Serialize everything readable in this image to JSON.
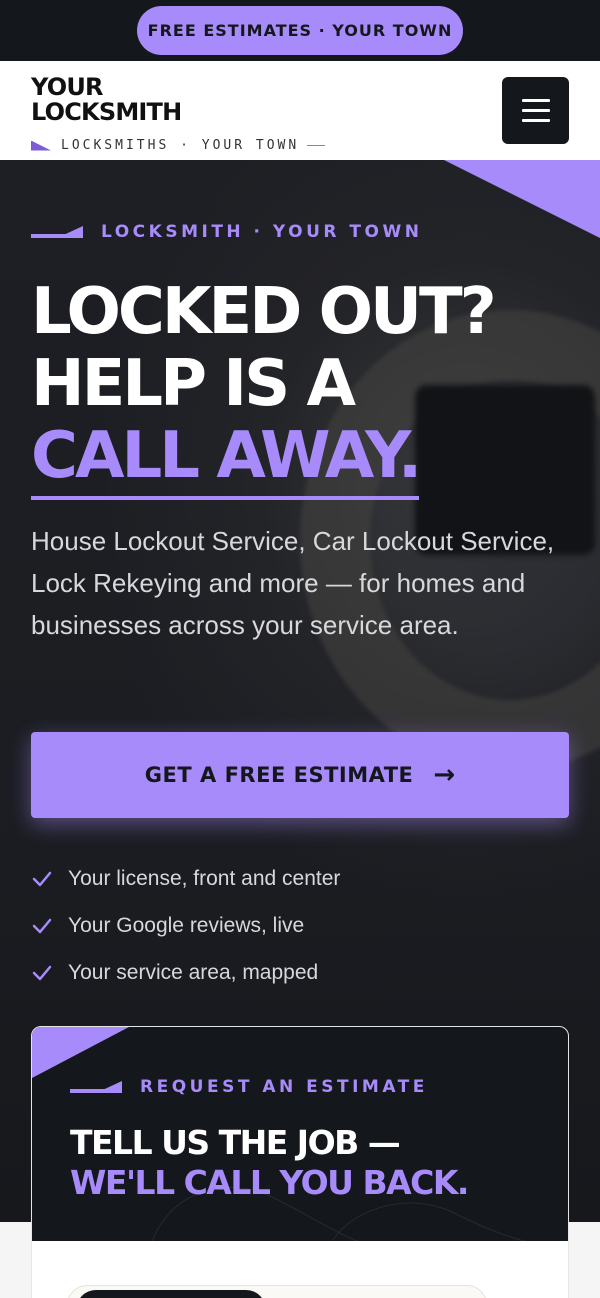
{
  "promo": {
    "label": "FREE ESTIMATES · YOUR TOWN"
  },
  "header": {
    "logo_line1": "YOUR",
    "logo_line2": "LOCKSMITH",
    "logo_sub": "LOCKSMITHS · YOUR TOWN",
    "menu_icon": "hamburger-icon"
  },
  "hero": {
    "eyebrow": "LOCKSMITH · YOUR TOWN",
    "headline_line1": "LOCKED OUT?",
    "headline_line2": "HELP IS A",
    "headline_accent": "CALL AWAY.",
    "description": "House Lockout Service, Car Lockout Service, Lock Rekeying and more — for homes and businesses across your service area.",
    "cta_label": "GET A FREE ESTIMATE",
    "cta_icon": "arrow-right-icon",
    "checklist": [
      "Your license, front and center",
      "Your Google reviews, live",
      "Your service area, mapped"
    ]
  },
  "estimate_card": {
    "eyebrow": "REQUEST AN ESTIMATE",
    "title_line1": "TELL US THE JOB —",
    "title_line2": "WE'LL CALL YOU BACK."
  },
  "colors": {
    "accent": "#a88bfa",
    "dark": "#14171c",
    "white": "#ffffff"
  }
}
